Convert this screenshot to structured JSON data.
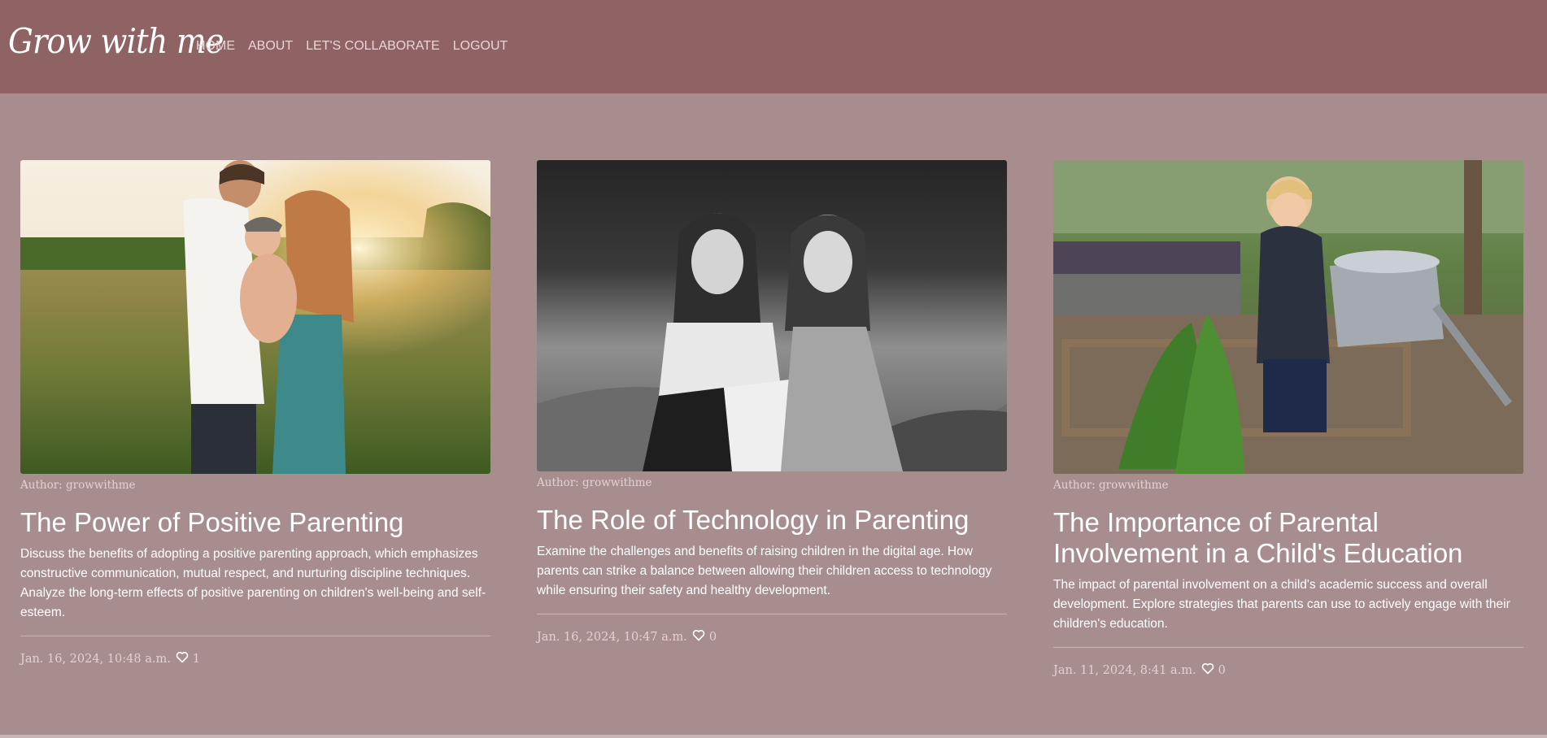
{
  "site": {
    "brand": "Grow with me",
    "nav": [
      "HOME",
      "ABOUT",
      "LET'S COLLABORATE",
      "LOGOUT"
    ]
  },
  "posts": [
    {
      "image_icon": "family-photo",
      "author": "Author: growwithme",
      "title": "The Power of Positive Parenting",
      "description": "Discuss the benefits of adopting a positive parenting approach, which emphasizes constructive communication, mutual respect, and nurturing discipline techniques. Analyze the long-term effects of positive parenting on children's well-being and self-esteem.",
      "date": "Jan. 16, 2024, 10:48 a.m.",
      "likes": "1"
    },
    {
      "image_icon": "children-photo",
      "author": "Author: growwithme",
      "title": "The Role of Technology in Parenting",
      "description": "Examine the challenges and benefits of raising children in the digital age. How parents can strike a balance between allowing their children access to technology while ensuring their safety and healthy development.",
      "date": "Jan. 16, 2024, 10:47 a.m.",
      "likes": "0"
    },
    {
      "image_icon": "garden-photo",
      "author": "Author: growwithme",
      "title": "The Importance of Parental Involvement in a Child's Education",
      "description": "The impact of parental involvement on a child's academic success and overall development. Explore strategies that parents can use to actively engage with their children's education.",
      "date": "Jan. 11, 2024, 8:41 a.m.",
      "likes": "0"
    }
  ],
  "colors": {
    "navbar": "#8f6264",
    "background": "#a88d8e",
    "text": "#ffffff"
  }
}
